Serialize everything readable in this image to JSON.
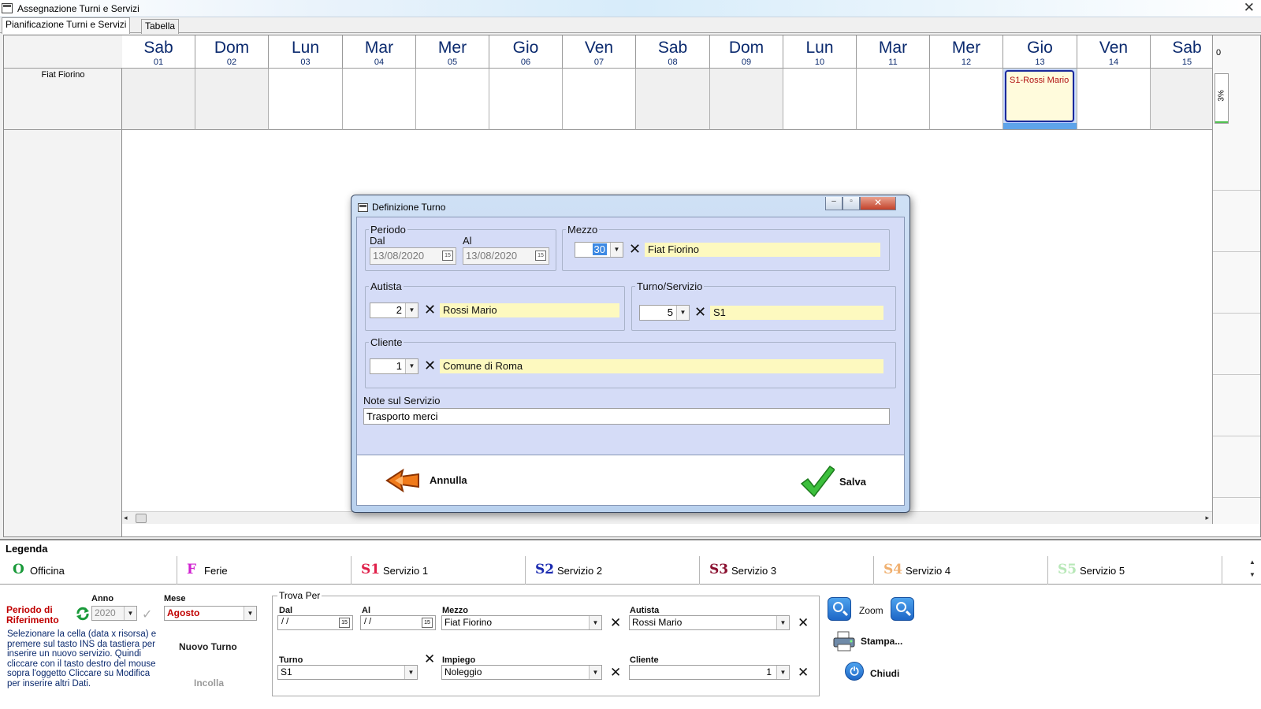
{
  "window": {
    "title": "Assegnazione Turni e Servizi",
    "close_glyph": "✕"
  },
  "tabs": [
    {
      "label": "Pianificazione Turni e Servizi",
      "active": true
    },
    {
      "label": "Tabella",
      "active": false
    }
  ],
  "calendar": {
    "row_label": "Fiat Fiorino",
    "days": [
      {
        "name": "Sab",
        "num": "01",
        "weekend": true
      },
      {
        "name": "Dom",
        "num": "02",
        "weekend": true
      },
      {
        "name": "Lun",
        "num": "03",
        "weekend": false
      },
      {
        "name": "Mar",
        "num": "04",
        "weekend": false
      },
      {
        "name": "Mer",
        "num": "05",
        "weekend": false
      },
      {
        "name": "Gio",
        "num": "06",
        "weekend": false
      },
      {
        "name": "Ven",
        "num": "07",
        "weekend": false
      },
      {
        "name": "Sab",
        "num": "08",
        "weekend": true
      },
      {
        "name": "Dom",
        "num": "09",
        "weekend": true
      },
      {
        "name": "Lun",
        "num": "10",
        "weekend": false
      },
      {
        "name": "Mar",
        "num": "11",
        "weekend": false
      },
      {
        "name": "Mer",
        "num": "12",
        "weekend": false
      },
      {
        "name": "Gio",
        "num": "13",
        "weekend": false
      },
      {
        "name": "Ven",
        "num": "14",
        "weekend": false
      },
      {
        "name": "Sab",
        "num": "15",
        "weekend": true
      }
    ],
    "shift_label": "S1-Rossi Mario",
    "ruler_top": "0",
    "usage_percent_label": "3%",
    "usage_fraction": 0.03
  },
  "dialog": {
    "title": "Definizione Turno",
    "periodo": {
      "legend": "Periodo",
      "dal_label": "Dal",
      "al_label": "Al",
      "dal": "13/08/2020",
      "al": "13/08/2020"
    },
    "mezzo": {
      "legend": "Mezzo",
      "code": "30",
      "name": "Fiat Fiorino"
    },
    "autista": {
      "legend": "Autista",
      "code": "2",
      "name": "Rossi Mario"
    },
    "turno": {
      "legend": "Turno/Servizio",
      "code": "5",
      "name": "S1"
    },
    "cliente": {
      "legend": "Cliente",
      "code": "1",
      "name": "Comune di Roma"
    },
    "note_label": "Note sul Servizio",
    "note_value": "Trasporto merci",
    "cancel_label": "Annulla",
    "save_label": "Salva",
    "clear_glyph": "✕"
  },
  "legend": {
    "title": "Legenda",
    "items": [
      {
        "code": "O",
        "name": "Officina",
        "color": "#1a9a3a"
      },
      {
        "code": "F",
        "name": "Ferie",
        "color": "#d020d0"
      },
      {
        "code": "S1",
        "name": "Servizio 1",
        "color": "#e0204a"
      },
      {
        "code": "S2",
        "name": "Servizio 2",
        "color": "#1a2ab0"
      },
      {
        "code": "S3",
        "name": "Servizio 3",
        "color": "#8a1030"
      },
      {
        "code": "S4",
        "name": "Servizio 4",
        "color": "#f0b070"
      },
      {
        "code": "S5",
        "name": "Servizio 5",
        "color": "#b8e8b8"
      }
    ]
  },
  "bottom": {
    "periodo_title": "Periodo di Riferimento",
    "anno_label": "Anno",
    "anno_value": "2020",
    "mese_label": "Mese",
    "mese_value": "Agosto",
    "hint": "Selezionare la cella (data x risorsa) e premere sul tasto INS da tastiera per inserire un nuovo servizio. Quindi cliccare con il tasto destro del mouse sopra l'oggetto Cliccare su Modifica per inserire altri Dati.",
    "nuovo_turno": "Nuovo Turno",
    "incolla": "Incolla",
    "trova": {
      "legend": "Trova Per",
      "dal_label": "Dal",
      "dal_value": " / /",
      "al_label": "Al",
      "al_value": " / /",
      "mezzo_label": "Mezzo",
      "mezzo_value": "Fiat Fiorino",
      "autista_label": "Autista",
      "autista_value": "Rossi Mario",
      "turno_label": "Turno",
      "turno_value": "S1",
      "impiego_label": "Impiego",
      "impiego_value": "Noleggio",
      "cliente_label": "Cliente",
      "cliente_value": "1"
    },
    "zoom_label": "Zoom",
    "stampa_label": "Stampa...",
    "chiudi_label": "Chiudi"
  }
}
